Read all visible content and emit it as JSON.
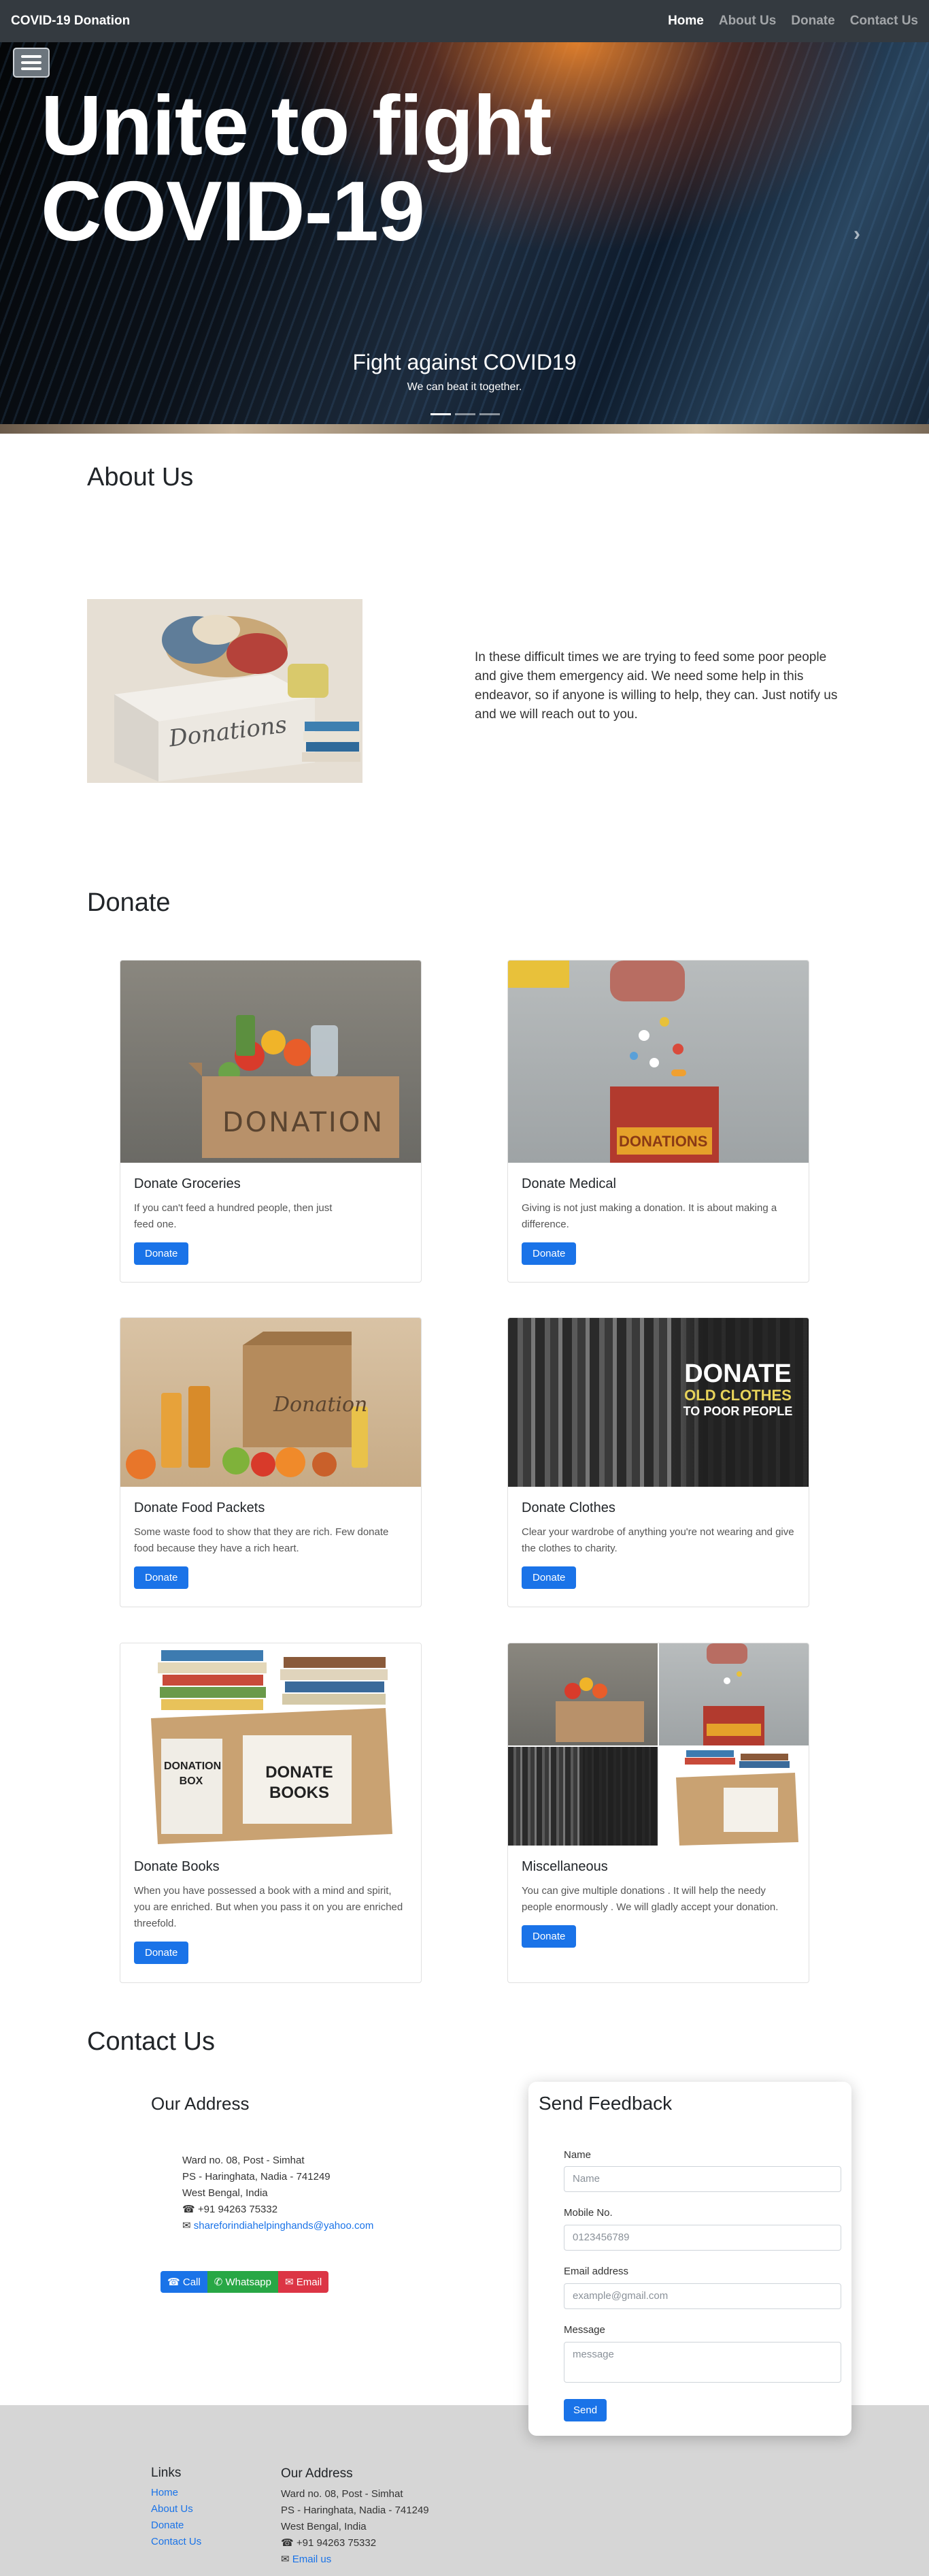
{
  "navbar": {
    "brand": "COVID-19 Donation",
    "links": [
      "Home",
      "About Us",
      "Donate",
      "Contact Us"
    ],
    "active": "Home"
  },
  "hero": {
    "title_line1": "Unite to fight",
    "title_line2": "COVID-19",
    "caption_title": "Fight against COVID19",
    "caption_text": "We can beat it together.",
    "slides": 3,
    "active_slide": 1
  },
  "about": {
    "title": "About Us",
    "text": "In these difficult times we are trying to feed some poor people and give them emergency aid. We need some help in this endeavor, so if anyone is willing to help, they can. Just notify us and we will reach out to you.",
    "image_label": "Donations"
  },
  "donate": {
    "title": "Donate",
    "button_label": "Donate",
    "cards": [
      {
        "title": "Donate Groceries",
        "text": "If you can't feed a hundred people, then just feed one.",
        "image_label": "DONATION"
      },
      {
        "title": "Donate Medical",
        "text": "Giving is not just making a donation. It is about making a difference.",
        "image_label": "DONATIONS"
      },
      {
        "title": "Donate Food Packets",
        "text": "Some waste food to show that they are rich. Few donate food because they have a rich heart.",
        "image_label": "Donation"
      },
      {
        "title": "Donate Clothes",
        "text": "Clear your wardrobe of anything you're not wearing and give the clothes to charity.",
        "image_label_1": "DONATE",
        "image_label_2": "OLD CLOTHES",
        "image_label_3": "TO POOR PEOPLE"
      },
      {
        "title": "Donate Books",
        "text": "When you have possessed a book with a mind and spirit, you are enriched. But when you pass it on you are enriched threefold.",
        "image_label_1": "DONATE BOOKS",
        "image_label_2": "DONATION BOX"
      },
      {
        "title": "Miscellaneous",
        "text": "You can give multiple donations . It will help the needy people enormously . We will gladly accept your donation."
      }
    ]
  },
  "contact": {
    "title": "Contact Us",
    "address_heading": "Our Address",
    "address_lines": [
      "Ward no. 08, Post - Simhat",
      "PS - Haringhata, Nadia - 741249",
      "West Bengal, India"
    ],
    "phone": "+91 94263 75332",
    "email": "shareforindiahelpinghands@yahoo.com",
    "buttons": {
      "call": "Call",
      "whatsapp": "Whatsapp",
      "email": "Email"
    }
  },
  "feedback": {
    "title": "Send Feedback",
    "name_label": "Name",
    "name_placeholder": "Name",
    "mobile_label": "Mobile No.",
    "mobile_placeholder": "0123456789",
    "email_label": "Email address",
    "email_placeholder": "example@gmail.com",
    "message_label": "Message",
    "message_placeholder": "message",
    "send_label": "Send"
  },
  "footer": {
    "links_heading": "Links",
    "links": [
      "Home",
      "About Us",
      "Donate",
      "Contact Us"
    ],
    "address_heading": "Our Address",
    "address_lines": [
      "Ward no. 08, Post - Simhat",
      "PS - Haringhata, Nadia - 741249",
      "West Bengal, India"
    ],
    "phone": "+91 94263 75332",
    "email_label": "Email us"
  },
  "colors": {
    "accent": "#1a73e8",
    "navbar": "#343a40",
    "whatsapp": "#28a745",
    "email_btn": "#dc3545",
    "footer": "#d6d6d6"
  },
  "icons": [
    "menu-icon",
    "chevron-right-icon",
    "phone-icon",
    "whatsapp-icon",
    "envelope-icon"
  ]
}
